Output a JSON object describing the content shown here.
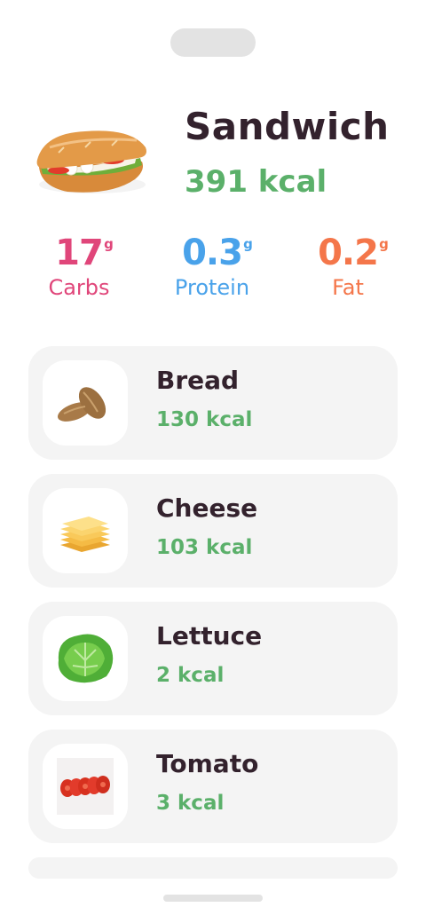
{
  "meal": {
    "title": "Sandwich",
    "kcal": "391 kcal",
    "image_icon": "sandwich-icon"
  },
  "macros": [
    {
      "value": "17",
      "unit": "g",
      "label": "Carbs",
      "color": "#e0467a"
    },
    {
      "value": "0.3",
      "unit": "g",
      "label": "Protein",
      "color": "#49a2ea"
    },
    {
      "value": "0.2",
      "unit": "g",
      "label": "Fat",
      "color": "#f4764a"
    }
  ],
  "ingredients": [
    {
      "name": "Bread",
      "kcal": "130 kcal",
      "icon": "bread-icon"
    },
    {
      "name": "Cheese",
      "kcal": "103 kcal",
      "icon": "cheese-icon"
    },
    {
      "name": "Lettuce",
      "kcal": "2 kcal",
      "icon": "lettuce-icon"
    },
    {
      "name": "Tomato",
      "kcal": "3 kcal",
      "icon": "tomato-icon"
    }
  ],
  "colors": {
    "accent_green": "#5bb06a",
    "text_dark": "#33222d",
    "card_bg": "#f4f4f4"
  }
}
